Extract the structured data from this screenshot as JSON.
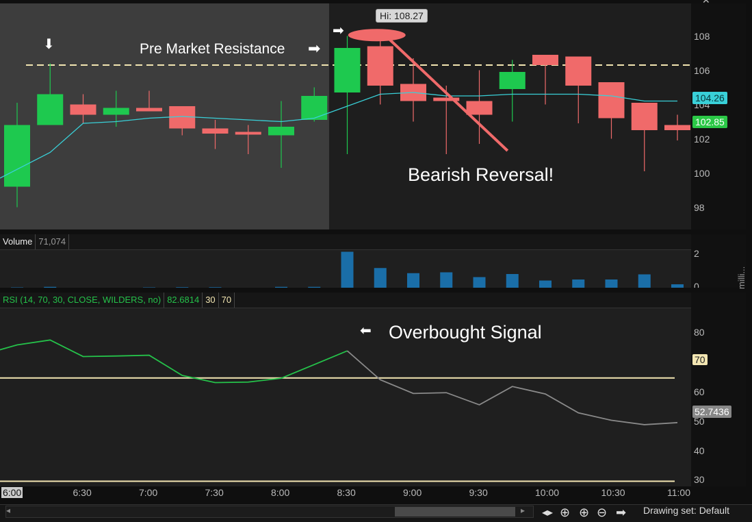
{
  "colors": {
    "bull": "#1ec94f",
    "bear": "#f06a6a",
    "ma": "#39d0d8",
    "resistance": "#f3e6b2",
    "rsi_up": "#25c24a",
    "rsi_down": "#8a8a8a",
    "volume": "#1a6ea8",
    "price_tag": "#2bc846",
    "ma_tag": "#39d0d8"
  },
  "price_axis": {
    "ticks": [
      "108",
      "106",
      "104",
      "102",
      "100",
      "98"
    ],
    "current_price": "102.85",
    "ma_value": "104.26"
  },
  "annotations": {
    "hi_label": "Hi: 108.27",
    "resistance": "Pre Market Resistance",
    "bearish": "Bearish Reversal!",
    "overbought": "Overbought Signal"
  },
  "volume": {
    "label": "Volume",
    "value": "71,074",
    "ticks": [
      "2",
      "0"
    ],
    "side_label": "milli..."
  },
  "rsi": {
    "label": "RSI (14, 70, 30, CLOSE, WILDERS, no)",
    "value": "82.6814",
    "upper": "30",
    "lower": "70",
    "ticks": [
      "80",
      "70",
      "60",
      "50",
      "40",
      "30"
    ],
    "level_tag": "70",
    "current": "52.7436"
  },
  "time_axis": {
    "labels": [
      "6:00",
      "6:30",
      "7:00",
      "7:30",
      "8:00",
      "8:30",
      "9:00",
      "9:30",
      "10:00",
      "10:30",
      "11:00"
    ]
  },
  "toolbar": {
    "drawing_set": "Drawing set: Default"
  },
  "chart_data": {
    "type": "candlestick",
    "x": [
      "6:00",
      "6:15",
      "6:30",
      "6:45",
      "7:00",
      "7:15",
      "7:30",
      "7:45",
      "8:00",
      "8:15",
      "8:30",
      "8:45",
      "9:00",
      "9:15",
      "9:30",
      "9:45",
      "10:00",
      "10:15",
      "10:30",
      "10:45",
      "11:00"
    ],
    "open": [
      99.3,
      102.9,
      104.1,
      103.5,
      103.9,
      104.0,
      102.7,
      102.5,
      102.3,
      103.2,
      104.8,
      107.5,
      105.3,
      104.5,
      104.3,
      105.0,
      107.0,
      106.9,
      105.4,
      104.2,
      102.9
    ],
    "high": [
      104.2,
      106.5,
      104.7,
      104.9,
      104.9,
      103.9,
      103.2,
      102.9,
      104.3,
      105.1,
      108.1,
      108.27,
      106.8,
      105.2,
      106.1,
      106.7,
      106.5,
      106.5,
      104.9,
      103.0,
      103.5
    ],
    "low": [
      98.1,
      102.9,
      103.0,
      102.8,
      103.7,
      102.3,
      101.5,
      101.2,
      100.4,
      103.1,
      101.2,
      104.1,
      103.1,
      101.2,
      101.8,
      103.1,
      104.1,
      103.0,
      102.1,
      100.2,
      102.0
    ],
    "close": [
      102.9,
      104.7,
      103.5,
      103.9,
      103.7,
      102.7,
      102.4,
      102.4,
      102.8,
      104.6,
      107.4,
      105.2,
      104.3,
      104.3,
      103.5,
      106.0,
      106.4,
      105.2,
      103.3,
      102.6,
      102.6
    ],
    "ma": [
      99.8,
      101.3,
      103.0,
      103.1,
      103.3,
      103.4,
      103.3,
      103.2,
      103.1,
      103.3,
      104.0,
      104.7,
      104.8,
      104.6,
      104.6,
      104.7,
      104.7,
      104.7,
      104.6,
      104.3,
      104.3
    ],
    "resistance_level": 106.4,
    "volume": [
      0.02,
      0.05,
      0.0,
      0.0,
      0.02,
      0.03,
      0.03,
      0.0,
      0.05,
      0.05,
      2.1,
      1.15,
      0.85,
      0.9,
      0.62,
      0.8,
      0.42,
      0.48,
      0.48,
      0.78,
      0.2
    ],
    "rsi": [
      79.2,
      82.8,
      84.7,
      78.3,
      78.5,
      78.8,
      71.0,
      68.2,
      68.4,
      69.9,
      75.2,
      80.5,
      69.3,
      64.0,
      64.3,
      59.6,
      66.7,
      63.8,
      56.5,
      53.6,
      51.9,
      52.7
    ],
    "rsi_x": [
      5.75,
      6.0,
      6.25,
      6.5,
      6.75,
      7.0,
      7.25,
      7.5,
      7.75,
      8.0,
      8.25,
      8.5,
      8.75,
      9.0,
      9.25,
      9.5,
      9.75,
      10.0,
      10.25,
      10.5,
      10.75,
      11.0
    ],
    "price_ylim": [
      96.8,
      110.0
    ],
    "rsi_ylim": [
      28,
      97
    ],
    "rsi_levels": [
      70,
      30
    ]
  }
}
